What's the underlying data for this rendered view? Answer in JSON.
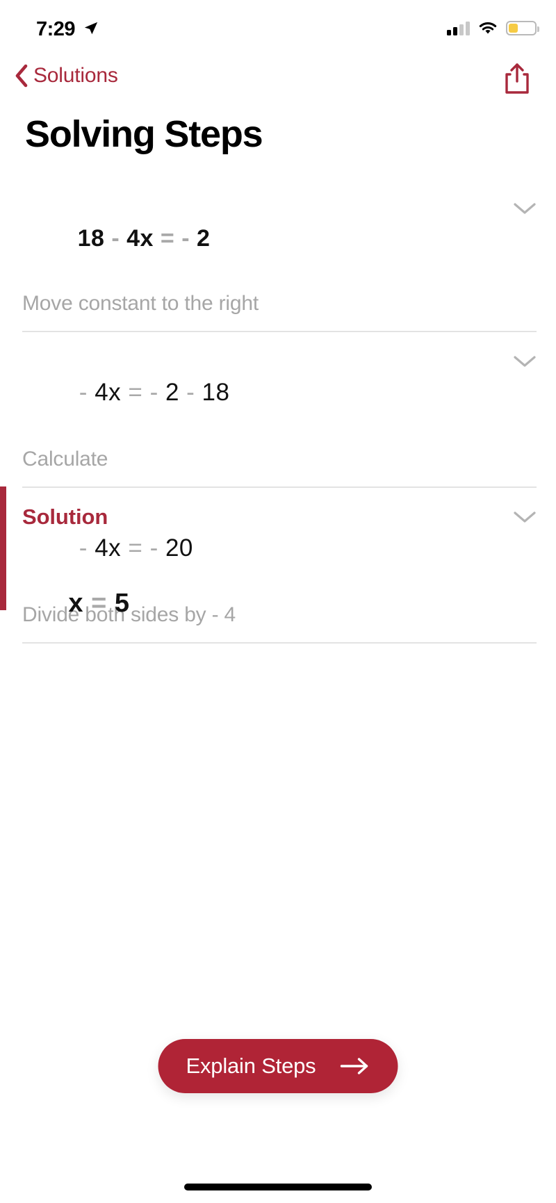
{
  "status_bar": {
    "time": "7:29",
    "location_icon": "location-arrow-icon",
    "signal_icon": "cellular-signal-icon",
    "signal_bars_filled": 2,
    "signal_bars_total": 4,
    "wifi_icon": "wifi-icon",
    "battery_icon": "battery-icon",
    "battery_fill_percent": 35,
    "battery_color": "#f6cb45"
  },
  "nav": {
    "back_label": "Solutions",
    "back_icon": "chevron-left-icon",
    "share_icon": "share-icon",
    "accent_color": "#a8293c"
  },
  "header": {
    "title": "Solving Steps"
  },
  "steps": [
    {
      "equation_plain": "18 - 4x = -2",
      "equation_parts": [
        {
          "t": "18",
          "op": false
        },
        {
          "t": " - ",
          "op": true
        },
        {
          "t": "4",
          "op": false
        },
        {
          "t": "x ",
          "op": false
        },
        {
          "t": "= ",
          "op": true
        },
        {
          "t": "- ",
          "op": true
        },
        {
          "t": "2",
          "op": false
        }
      ],
      "description": "Move constant to the right",
      "expand_icon": "chevron-down-icon",
      "bold": true
    },
    {
      "equation_plain": "-4x = -2 - 18",
      "equation_parts": [
        {
          "t": "- ",
          "op": true
        },
        {
          "t": "4",
          "op": false
        },
        {
          "t": "x ",
          "op": false
        },
        {
          "t": "= ",
          "op": true
        },
        {
          "t": "- ",
          "op": true
        },
        {
          "t": "2 ",
          "op": false
        },
        {
          "t": "- ",
          "op": true
        },
        {
          "t": "18",
          "op": false
        }
      ],
      "description": "Calculate",
      "expand_icon": "chevron-down-icon",
      "bold": false
    },
    {
      "equation_plain": "-4x = -20",
      "equation_parts": [
        {
          "t": "- ",
          "op": true
        },
        {
          "t": "4",
          "op": false
        },
        {
          "t": "x ",
          "op": false
        },
        {
          "t": "= ",
          "op": true
        },
        {
          "t": "- ",
          "op": true
        },
        {
          "t": "20",
          "op": false
        }
      ],
      "description": "Divide both sides by - 4",
      "expand_icon": "chevron-down-icon",
      "bold": false
    }
  ],
  "solution": {
    "label": "Solution",
    "equation_plain": "x = 5",
    "equation_parts": [
      {
        "t": "x ",
        "op": false
      },
      {
        "t": "= ",
        "op": true
      },
      {
        "t": "5",
        "op": false
      }
    ],
    "accent_color": "#a8293c"
  },
  "cta": {
    "label": "Explain Steps",
    "arrow_icon": "arrow-right-icon",
    "background_color": "#b02436"
  },
  "home_indicator": "home-indicator"
}
